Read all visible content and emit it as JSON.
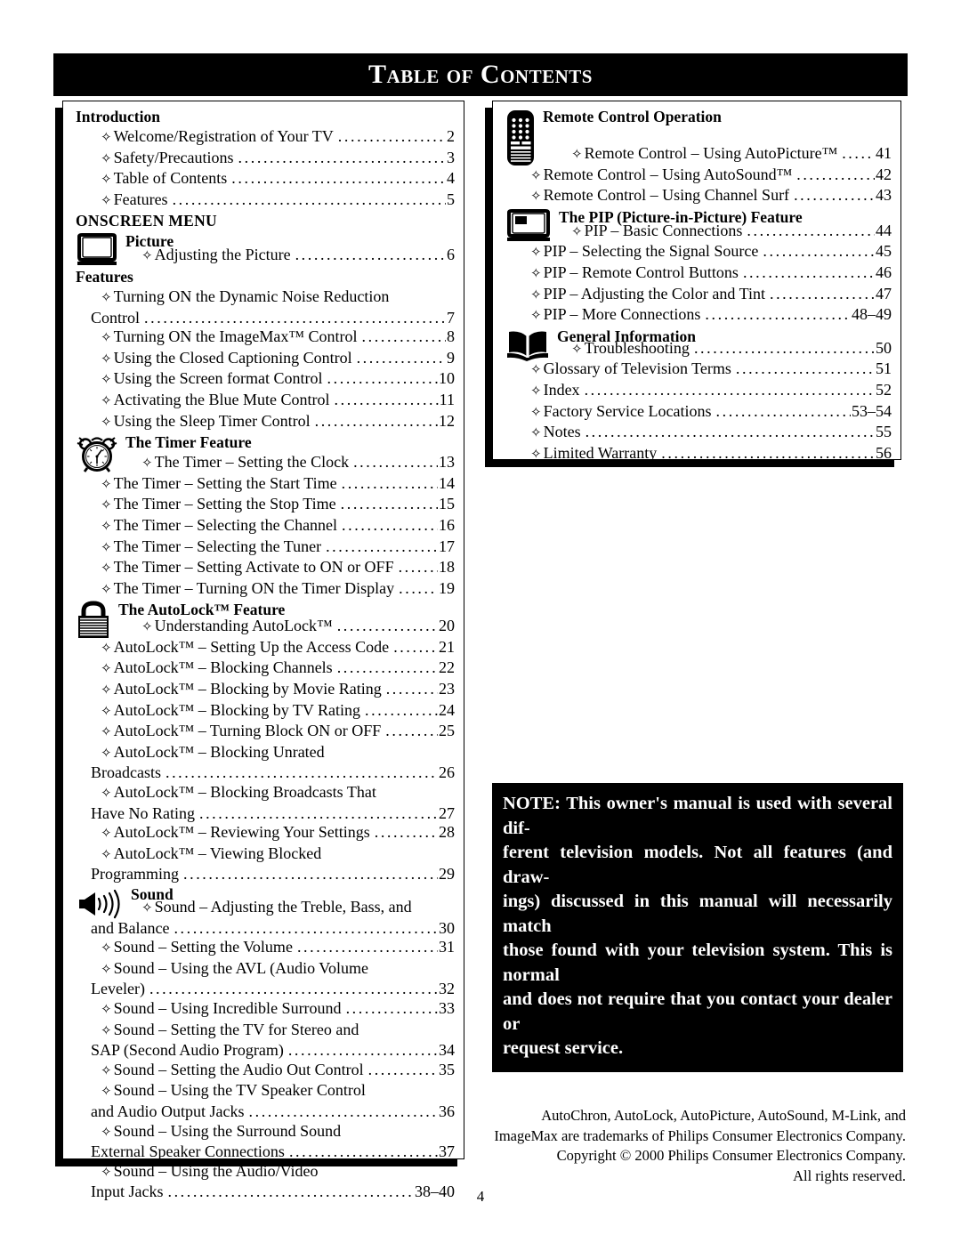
{
  "page": {
    "title": "Table of Contents",
    "page_number": "4"
  },
  "bullet": "✧",
  "left_column": [
    {
      "type": "group",
      "heading": "Introduction",
      "entries": [
        {
          "text": "Welcome/Registration of Your TV",
          "page": "2"
        },
        {
          "text": "Safety/Precautions",
          "page": "3"
        },
        {
          "text": "Table of Contents",
          "page": "4"
        },
        {
          "text": "Features",
          "page": "5"
        }
      ]
    },
    {
      "type": "caps-heading",
      "heading": "ONSCREEN MENU"
    },
    {
      "type": "icon-group",
      "icon": "tv-picture-icon",
      "heading": "Picture",
      "entries": [
        {
          "text": "Adjusting the Picture",
          "page": "6"
        }
      ]
    },
    {
      "type": "group",
      "heading": "Features",
      "entries": [
        {
          "text": "Turning ON the Dynamic Noise Reduction",
          "cont": "Control",
          "page": "7"
        },
        {
          "text": "Turning ON the ImageMax™ Control",
          "page": "8"
        },
        {
          "text": "Using the Closed Captioning Control",
          "page": "9"
        },
        {
          "text": "Using the Screen format Control",
          "page": "10"
        },
        {
          "text": "Activating the Blue Mute Control",
          "page": "11"
        },
        {
          "text": "Using the Sleep Timer Control",
          "page": "12"
        }
      ]
    },
    {
      "type": "icon-group",
      "icon": "alarm-clock-icon",
      "heading": "The Timer Feature",
      "entries": [
        {
          "text": "The Timer – Setting the Clock",
          "page": "13"
        },
        {
          "text": "The Timer – Setting the Start Time",
          "page": "14"
        },
        {
          "text": "The Timer – Setting the Stop Time",
          "page": "15"
        },
        {
          "text": "The Timer – Selecting the Channel",
          "page": "16"
        },
        {
          "text": "The Timer – Selecting the Tuner",
          "page": "17"
        },
        {
          "text": "The Timer – Setting Activate to ON or OFF",
          "page": "18"
        },
        {
          "text": "The Timer – Turning ON the Timer Display",
          "page": "19"
        }
      ]
    },
    {
      "type": "icon-group",
      "icon": "padlock-icon",
      "heading": "The AutoLock™ Feature",
      "entries": [
        {
          "text": "Understanding AutoLock™",
          "page": "20"
        },
        {
          "text": "AutoLock™ – Setting Up the Access Code",
          "page": "21"
        },
        {
          "text": "AutoLock™ – Blocking Channels",
          "page": "22"
        },
        {
          "text": "AutoLock™ – Blocking by Movie Rating",
          "page": "23"
        },
        {
          "text": "AutoLock™ – Blocking by TV Rating",
          "page": "24"
        },
        {
          "text": "AutoLock™ – Turning Block ON or OFF",
          "page": "25"
        },
        {
          "text": "AutoLock™ – Blocking Unrated",
          "cont": "Broadcasts",
          "page": "26"
        },
        {
          "text": "AutoLock™ – Blocking Broadcasts That",
          "cont": "Have No Rating",
          "page": "27"
        },
        {
          "text": "AutoLock™ – Reviewing Your Settings",
          "page": "28"
        },
        {
          "text": "AutoLock™ – Viewing Blocked",
          "cont": "Programming",
          "page": "29"
        }
      ]
    },
    {
      "type": "icon-group",
      "icon": "speaker-icon",
      "heading": "Sound",
      "entries": [
        {
          "text": "Sound – Adjusting the Treble, Bass, and",
          "cont": "and Balance",
          "page": "30"
        },
        {
          "text": "Sound – Setting the Volume",
          "page": "31"
        },
        {
          "text": "Sound – Using the AVL (Audio Volume",
          "cont": "Leveler)",
          "page": "32"
        },
        {
          "text": "Sound – Using Incredible Surround",
          "page": "33"
        },
        {
          "text": "Sound – Setting the TV for Stereo and",
          "cont": "SAP (Second Audio Program)",
          "page": "34"
        },
        {
          "text": "Sound – Setting the Audio Out Control",
          "page": "35"
        },
        {
          "text": "Sound – Using the TV Speaker Control",
          "cont": "and Audio Output Jacks",
          "page": "36"
        },
        {
          "text": "Sound – Using the Surround Sound",
          "cont": "External Speaker Connections",
          "page": "37"
        },
        {
          "text": "Sound – Using the Audio/Video",
          "cont": "Input Jacks",
          "page": "38–40"
        }
      ]
    }
  ],
  "right_column": [
    {
      "type": "icon-group",
      "icon": "remote-control-icon",
      "heading": "Remote Control Operation",
      "entries": [
        {
          "text": "Remote Control – Using AutoPicture™",
          "page": "41"
        },
        {
          "text": "Remote Control – Using AutoSound™",
          "page": "42"
        },
        {
          "text": "Remote Control – Using Channel Surf",
          "page": "43"
        }
      ]
    },
    {
      "type": "icon-group",
      "icon": "pip-tv-icon",
      "heading": "The PIP (Picture-in-Picture) Feature",
      "entries": [
        {
          "text": "PIP – Basic Connections",
          "page": "44"
        },
        {
          "text": "PIP – Selecting the Signal Source",
          "page": "45"
        },
        {
          "text": "PIP – Remote Control Buttons",
          "page": "46"
        },
        {
          "text": "PIP – Adjusting the Color and Tint",
          "page": "47"
        },
        {
          "text": "PIP – More Connections",
          "page": "48–49"
        }
      ]
    },
    {
      "type": "icon-group",
      "icon": "open-book-icon",
      "heading": "General Information",
      "entries": [
        {
          "text": "Troubleshooting",
          "page": "50"
        },
        {
          "text": "Glossary of Television Terms",
          "page": "51"
        },
        {
          "text": "Index",
          "page": "52"
        },
        {
          "text": "Factory Service Locations",
          "page": "53–54"
        },
        {
          "text": "Notes",
          "page": "55"
        },
        {
          "text": "Limited Warranty",
          "page": "56"
        }
      ]
    }
  ],
  "note": {
    "lines": [
      "NOTE: This owner's manual is used with several dif-",
      "ferent television models.  Not all features (and  draw-",
      "ings) discussed in this manual will necessarily match",
      "those found with your television system. This is normal",
      "and does not require that you contact your dealer or",
      "request service."
    ]
  },
  "trademark": {
    "lines": [
      "AutoChron, AutoLock, AutoPicture, AutoSound, M-Link, and",
      "ImageMax are trademarks of Philips Consumer Electronics Company.",
      "Copyright © 2000 Philips Consumer Electronics Company.",
      "All rights reserved."
    ]
  }
}
